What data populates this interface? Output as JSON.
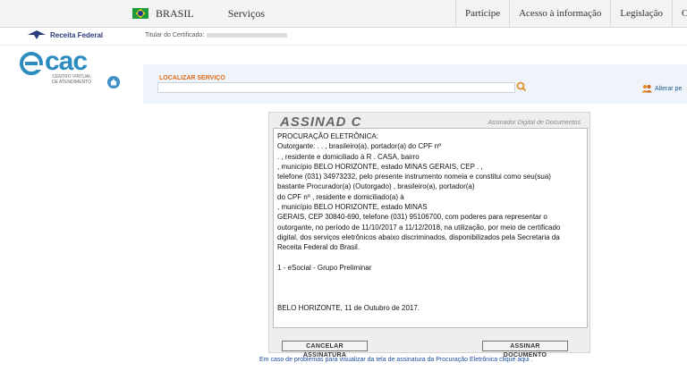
{
  "gov_bar": {
    "brasil_label": "BRASIL",
    "servicos_label": "Serviços",
    "right_links": [
      "Participe",
      "Acesso à informação",
      "Legislação",
      "Can"
    ]
  },
  "header": {
    "rf_name": "Receita Federal",
    "titular_label": "Titular do Certificado:"
  },
  "ecac": {
    "logo_text": "cac",
    "subtitle": "CENTRO VIRTUAL DE ATENDIMENTO"
  },
  "search": {
    "label": "LOCALIZAR SERVIÇO",
    "value": "",
    "alterar_label": "Alterar pe"
  },
  "signer": {
    "title": "ASSINAD C",
    "subtitle": "Assinador Digital de Documentos",
    "document": {
      "heading": "PROCURAÇÃO ELETRÔNICA:",
      "body": [
        "Outorgante: . . , brasileiro(a), portador(a) do CPF nº",
        ". , residente e domiciliado à R . CASA, bairro",
        ", município BELO HORIZONTE, estado MINAS GERAIS, CEP . ,",
        "telefone (031) 34973232, pelo presente instrumento nomeia e constitui como seu(sua)",
        "bastante Procurador(a) (Outorgado) , brasileiro(a), portador(a)",
        "do CPF nº , residente e domiciliado(a) à",
        ", município BELO HORIZONTE, estado MINAS",
        "GERAIS, CEP 30840-690, telefone (031) 95106700, com poderes para representar o",
        "outorgante, no período de 11/10/2017 a 11/12/2018, na utilização, por meio de certificado",
        "digital, dos serviços eletrônicos abaixo discriminados, disponibilizados pela Secretaria da",
        "Receita Federal do Brasil."
      ],
      "service_item": "1 - eSocial - Grupo Preliminar",
      "closing": "BELO HORIZONTE, 11 de Outubro de 2017."
    },
    "cancel_label": "CANCELAR ASSINATURA",
    "sign_label": "ASSINAR DOCUMENTO"
  },
  "footer_note": "Em caso de problemas para visualizar da tela de assinatura da Procuração Eletrônica clique aqui .",
  "colors": {
    "ecac_blue": "#2c8cbf",
    "label_orange": "#e06a1b",
    "link_blue": "#1d4fa3"
  }
}
